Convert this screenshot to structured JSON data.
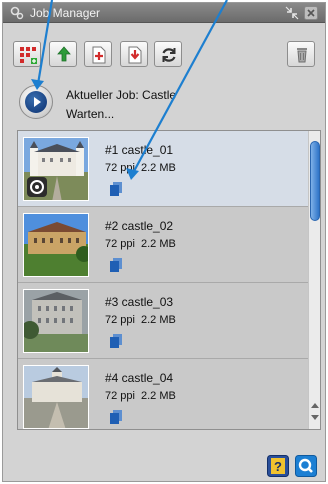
{
  "window": {
    "title": "Job Manager",
    "accent_color": "#1d7fd0"
  },
  "toolbar": {
    "buttons": [
      {
        "icon": "grid-add-icon"
      },
      {
        "icon": "import-arrow-icon"
      },
      {
        "icon": "add-document-icon"
      },
      {
        "icon": "export-document-icon"
      },
      {
        "icon": "refresh-icon"
      }
    ],
    "trash_icon": "trash-icon"
  },
  "job": {
    "current": "Aktueller Job: Castle",
    "status": "Warten..."
  },
  "items": [
    {
      "name": "#1 castle_01",
      "ppi": "72 ppi",
      "size": "2.2 MB",
      "selected": true
    },
    {
      "name": "#2 castle_02",
      "ppi": "72 ppi",
      "size": "2.2 MB",
      "selected": false
    },
    {
      "name": "#3 castle_03",
      "ppi": "72 ppi",
      "size": "2.2 MB",
      "selected": false
    },
    {
      "name": "#4 castle_04",
      "ppi": "72 ppi",
      "size": "2.2 MB",
      "selected": false
    }
  ],
  "bottom": {
    "help_icon": "help-icon",
    "search_icon": "quick-search-icon"
  }
}
